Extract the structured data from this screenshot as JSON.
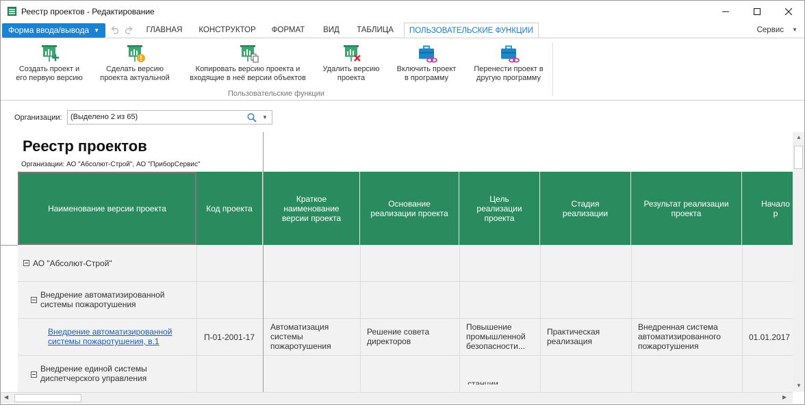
{
  "window": {
    "title": "Реестр проектов - Редактирование"
  },
  "toolbar": {
    "file_menu_label": "Форма ввода/вывода",
    "tabs": [
      {
        "label": "ГЛАВНАЯ"
      },
      {
        "label": "КОНСТРУКТОР"
      },
      {
        "label": "ФОРМАТ"
      },
      {
        "label": "ВИД"
      },
      {
        "label": "ТАБЛИЦА"
      },
      {
        "label": "ПОЛЬЗОВАТЕЛЬСКИЕ ФУНКЦИИ"
      }
    ],
    "service_label": "Сервис"
  },
  "ribbon": {
    "buttons": [
      {
        "label": "Создать проект и\nего первую версию",
        "icon": "create-project-icon"
      },
      {
        "label": "Сделать версию\nпроекта актуальной",
        "icon": "make-current-icon"
      },
      {
        "label": "Копировать версию проекта и\nвходящие в неё версии объектов",
        "icon": "copy-version-icon"
      },
      {
        "label": "Удалить версию\nпроекта",
        "icon": "delete-version-icon"
      },
      {
        "label": "Включить проект\nв программу",
        "icon": "include-program-icon"
      },
      {
        "label": "Перенести проект в\nдругую программу",
        "icon": "move-program-icon"
      }
    ],
    "group_label": "Пользовательские функции",
    "accent_green": "#2a8c5e",
    "accent_blue": "#1a82d3"
  },
  "filter": {
    "label": "Организации:",
    "value": "(Выделено 2 из 65)"
  },
  "report": {
    "title": "Реестр проектов",
    "subtitle": "Организации: АО \"Абсолют-Строй\", АО \"ПриборСервис\"",
    "columns": [
      "Наименование версии проекта",
      "Код проекта",
      "Краткое\nнаименование\nверсии проекта",
      "Основание\nреализации проекта",
      "Цель\nреализации\nпроекта",
      "Стадия\nреализации",
      "Результат реализации\nпроекта",
      "Начало р"
    ],
    "rows": [
      {
        "name": "АО \"Абсолют-Строй\""
      },
      {
        "name": "Внедрение автоматизированной\nсистемы пожаротушения"
      },
      {
        "name": "Внедрение автоматизированной\nсистемы пожаротушения, в.1",
        "code": "П-01-2001-17",
        "short_name": "Автоматизация\nсистемы\nпожаротушения",
        "basis": "Решение совета\nдиректоров",
        "goal": "Повышение\nпромышленной\nбезопасности...",
        "stage": "Практическая\nреализация",
        "result": "Внедренная система\nавтоматизированного\nпожаротушения",
        "start": "01.01.2017"
      },
      {
        "name": "Внедрение единой системы\nдиспетчерского управления",
        "goal_partial": "станции"
      }
    ]
  }
}
